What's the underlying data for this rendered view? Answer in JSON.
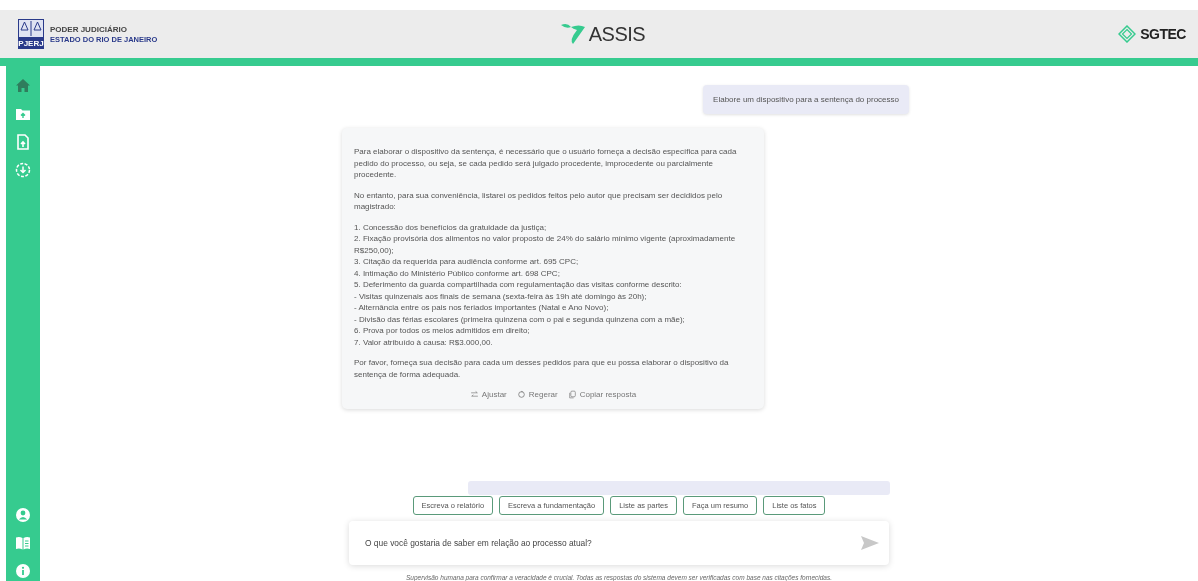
{
  "header": {
    "org_title": "PODER JUDICIÁRIO",
    "org_subtitle": "ESTADO DO RIO DE JANEIRO",
    "logo_badge": "PJERJ",
    "app_name": "ASSIS",
    "partner": "SGTEC"
  },
  "sidebar": {
    "top_items": [
      {
        "kind": "home",
        "selected": true
      },
      {
        "kind": "folder-upload",
        "selected": false
      },
      {
        "kind": "file-upload",
        "selected": false
      },
      {
        "kind": "download",
        "selected": false
      }
    ],
    "bottom_items": [
      {
        "kind": "user",
        "selected": false
      },
      {
        "kind": "book",
        "selected": false
      },
      {
        "kind": "info",
        "selected": false
      }
    ]
  },
  "chat": {
    "messages": [
      {
        "kind": "user",
        "text": "Elabore um dispositivo para a sentença do processo"
      },
      {
        "kind": "assistant",
        "blocks": [
          {
            "lines": [
              "Para elaborar o dispositivo da sentença, é necessário que o usuário forneça a decisão específica para cada pedido do processo, ou seja, se cada pedido será julgado procedente, improcedente ou parcialmente procedente."
            ]
          },
          {
            "lines": [
              "No entanto, para sua conveniência, listarei os pedidos feitos pelo autor que precisam ser decididos pelo magistrado:"
            ]
          },
          {
            "lines": [
              "1. Concessão dos benefícios da gratuidade da justiça;",
              "2. Fixação provisória dos alimentos no valor proposto de 24% do salário mínimo vigente (aproximadamente R$250,00);",
              "3. Citação da requerida para audiência conforme art. 695 CPC;",
              "4. Intimação do Ministério Público conforme art. 698 CPC;",
              "5. Deferimento da guarda compartilhada com regulamentação das visitas conforme descrito:",
              "- Visitas quinzenais aos finais de semana (sexta-feira às 19h até domingo às 20h);",
              "- Alternância entre os pais nos feriados importantes (Natal e Ano Novo);",
              "- Divisão das férias escolares (primeira quinzena com o pai e segunda quinzena com a mãe);",
              "6. Prova por todos os meios admitidos em direito;",
              "7. Valor atribuído à causa: R$3.000,00."
            ]
          },
          {
            "lines": [
              "Por favor, forneça sua decisão para cada um desses pedidos para que eu possa elaborar o dispositivo da sentença de forma adequada."
            ]
          }
        ],
        "actions": [
          {
            "kind": "adjust",
            "label": "Ajustar"
          },
          {
            "kind": "regenerate",
            "label": "Regerar"
          },
          {
            "kind": "copy",
            "label": "Copiar resposta"
          }
        ]
      },
      {
        "kind": "user-hidden"
      }
    ]
  },
  "suggestions": [
    "Escreva o relatório",
    "Escreva a fundamentação",
    "Liste as partes",
    "Faça um resumo",
    "Liste os fatos"
  ],
  "input": {
    "placeholder": "O que você gostaria de saber em relação ao processo atual?"
  },
  "disclaimer": "Supervisão humana para confirmar a veracidade é crucial. Todas as respostas do sistema devem ser verificadas com base nas citações fornecidas."
}
